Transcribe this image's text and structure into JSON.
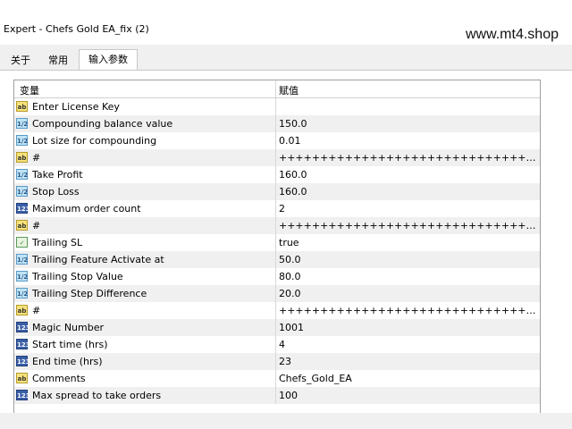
{
  "window": {
    "title": "Expert - Chefs Gold EA_fix (2)"
  },
  "watermark": "www.mt4.shop",
  "tabs": [
    {
      "label": "关于"
    },
    {
      "label": "常用"
    },
    {
      "label": "输入参数"
    }
  ],
  "grid": {
    "headers": {
      "variable": "变量",
      "value": "赋值"
    },
    "rows": [
      {
        "icon": "ab",
        "name": "Enter License Key",
        "value": ""
      },
      {
        "icon": "1/2",
        "name": "Compounding balance value",
        "value": "150.0"
      },
      {
        "icon": "1/2",
        "name": "Lot size for compounding",
        "value": "0.01"
      },
      {
        "icon": "ab",
        "name": "#",
        "value": "++++++++++++++++++++++++++++++++++++++++..."
      },
      {
        "icon": "1/2",
        "name": "Take Profit",
        "value": "160.0"
      },
      {
        "icon": "1/2",
        "name": "Stop Loss",
        "value": "160.0"
      },
      {
        "icon": "123",
        "name": "Maximum order count",
        "value": "2"
      },
      {
        "icon": "ab",
        "name": "#",
        "value": "++++++++++++++++++++++++++++++++++++++++..."
      },
      {
        "icon": "bool",
        "name": "Trailing SL",
        "value": "true"
      },
      {
        "icon": "1/2",
        "name": "Trailing Feature Activate at",
        "value": "50.0"
      },
      {
        "icon": "1/2",
        "name": "Trailing Stop Value",
        "value": "80.0"
      },
      {
        "icon": "1/2",
        "name": "Trailing Step Difference",
        "value": "20.0"
      },
      {
        "icon": "ab",
        "name": "#",
        "value": "++++++++++++++++++++++++++++++++++++++++..."
      },
      {
        "icon": "123",
        "name": "Magic Number",
        "value": "1001"
      },
      {
        "icon": "123",
        "name": "Start time (hrs)",
        "value": "4"
      },
      {
        "icon": "123",
        "name": "End time (hrs)",
        "value": "23"
      },
      {
        "icon": "ab",
        "name": "Comments",
        "value": "Chefs_Gold_EA"
      },
      {
        "icon": "123",
        "name": "Max spread to take  orders",
        "value": "100"
      }
    ]
  }
}
